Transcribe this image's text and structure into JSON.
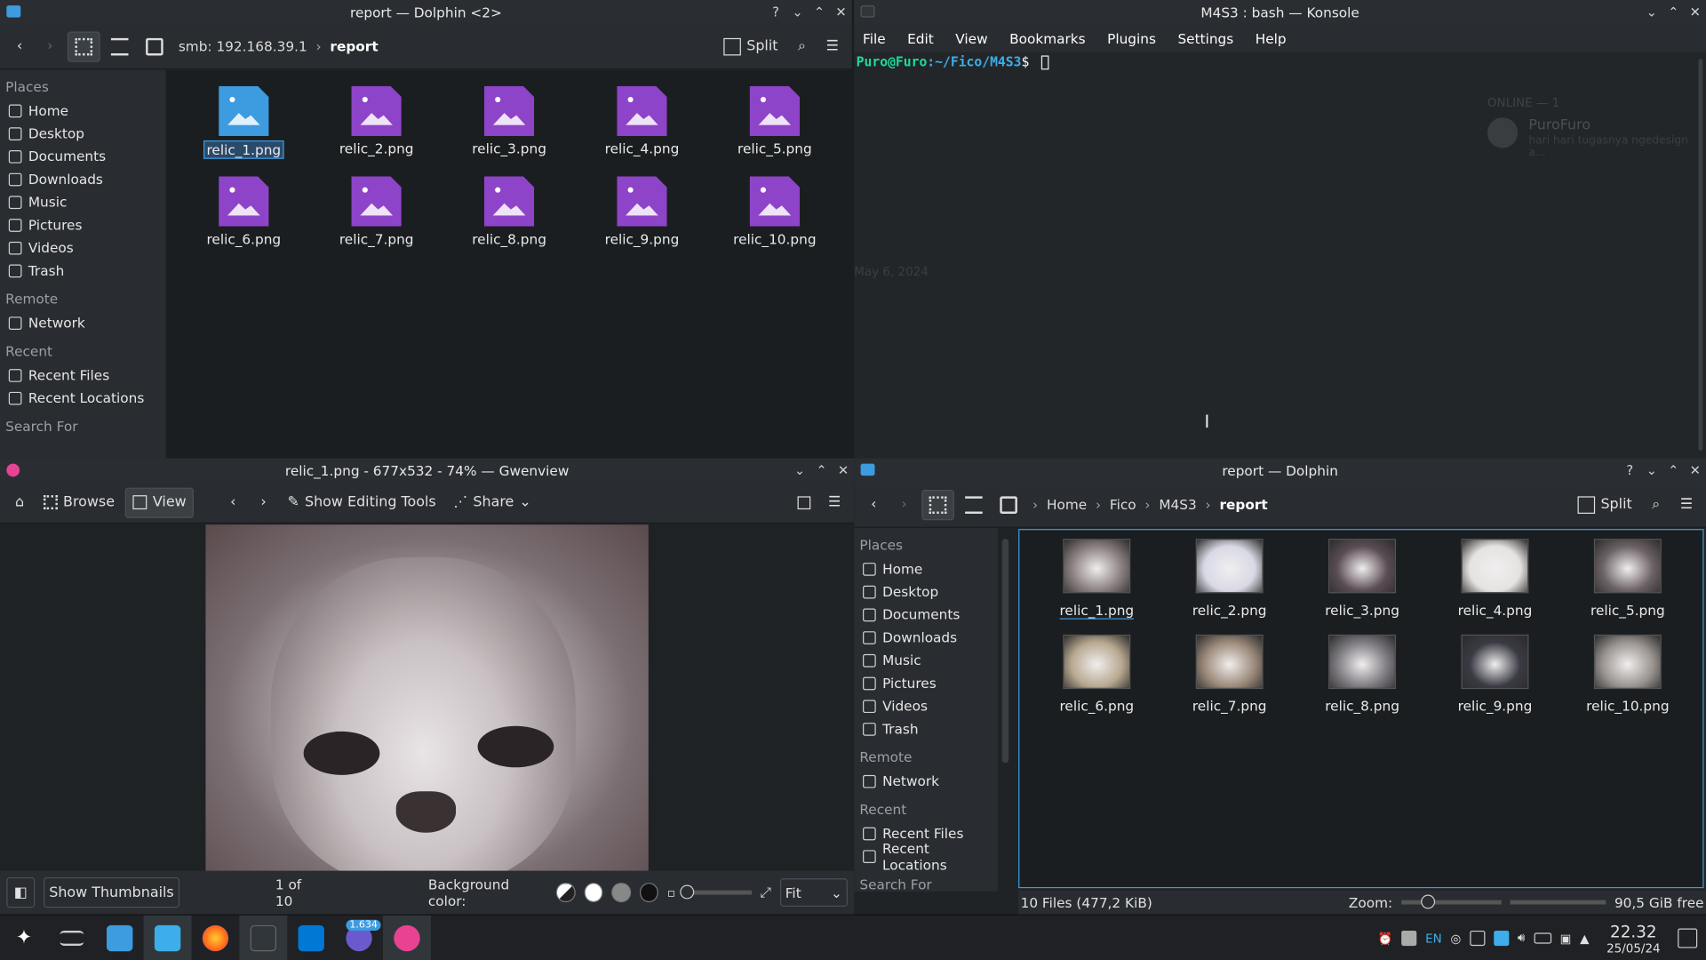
{
  "dolphin_top": {
    "title": "report — Dolphin <2>",
    "path": {
      "host": "smb: 192.168.39.1",
      "folder": "report"
    },
    "split_label": "Split",
    "places_head": "Places",
    "places": [
      "Home",
      "Desktop",
      "Documents",
      "Downloads",
      "Music",
      "Pictures",
      "Videos",
      "Trash"
    ],
    "remote_head": "Remote",
    "remote": [
      "Network"
    ],
    "recent_head": "Recent",
    "recent": [
      "Recent Files",
      "Recent Locations"
    ],
    "search_head": "Search For",
    "files": [
      "relic_1.png",
      "relic_2.png",
      "relic_3.png",
      "relic_4.png",
      "relic_5.png",
      "relic_6.png",
      "relic_7.png",
      "relic_8.png",
      "relic_9.png",
      "relic_10.png"
    ]
  },
  "konsole": {
    "title": "M4S3 : bash — Konsole",
    "menu": [
      "File",
      "Edit",
      "View",
      "Bookmarks",
      "Plugins",
      "Settings",
      "Help"
    ],
    "prompt_user": "Puro@Furo",
    "prompt_path": ":~/Fico/M4S3",
    "prompt_sym": "$",
    "ghost_online": "ONLINE — 1",
    "ghost_name": "PuroFuro",
    "ghost_status": "hari hari tugasnya ngedesign a...",
    "ghost_date": "May 6, 2024"
  },
  "gwenview": {
    "title": "relic_1.png - 677x532 - 74% — Gwenview",
    "browse_label": "Browse",
    "view_label": "View",
    "editing_label": "Show Editing Tools",
    "share_label": "Share",
    "thumbnails_label": "Show Thumbnails",
    "counter": "1 of 10",
    "bg_color_label": "Background color:",
    "zoom_mode": "Fit"
  },
  "dolphin_bottom": {
    "title": "report — Dolphin",
    "path": [
      "Home",
      "Fico",
      "M4S3",
      "report"
    ],
    "split_label": "Split",
    "places_head": "Places",
    "places": [
      "Home",
      "Desktop",
      "Documents",
      "Downloads",
      "Music",
      "Pictures",
      "Videos",
      "Trash"
    ],
    "remote_head": "Remote",
    "remote": [
      "Network"
    ],
    "recent_head": "Recent",
    "recent": [
      "Recent Files",
      "Recent Locations"
    ],
    "search_head": "Search For",
    "files": [
      "relic_1.png",
      "relic_2.png",
      "relic_3.png",
      "relic_4.png",
      "relic_5.png",
      "relic_6.png",
      "relic_7.png",
      "relic_8.png",
      "relic_9.png",
      "relic_10.png"
    ],
    "status_count": "10 Files (477,2 KiB)",
    "zoom_label": "Zoom:",
    "free_space": "90,5 GiB free"
  },
  "taskbar": {
    "badge": "1.634",
    "lang": "EN",
    "time": "22.32",
    "date": "25/05/24"
  },
  "colors": {
    "accent": "#3d9be0",
    "image_icon": "#8e44c8",
    "prompt_green": "#1cdc9a",
    "prompt_blue": "#3daee9"
  }
}
